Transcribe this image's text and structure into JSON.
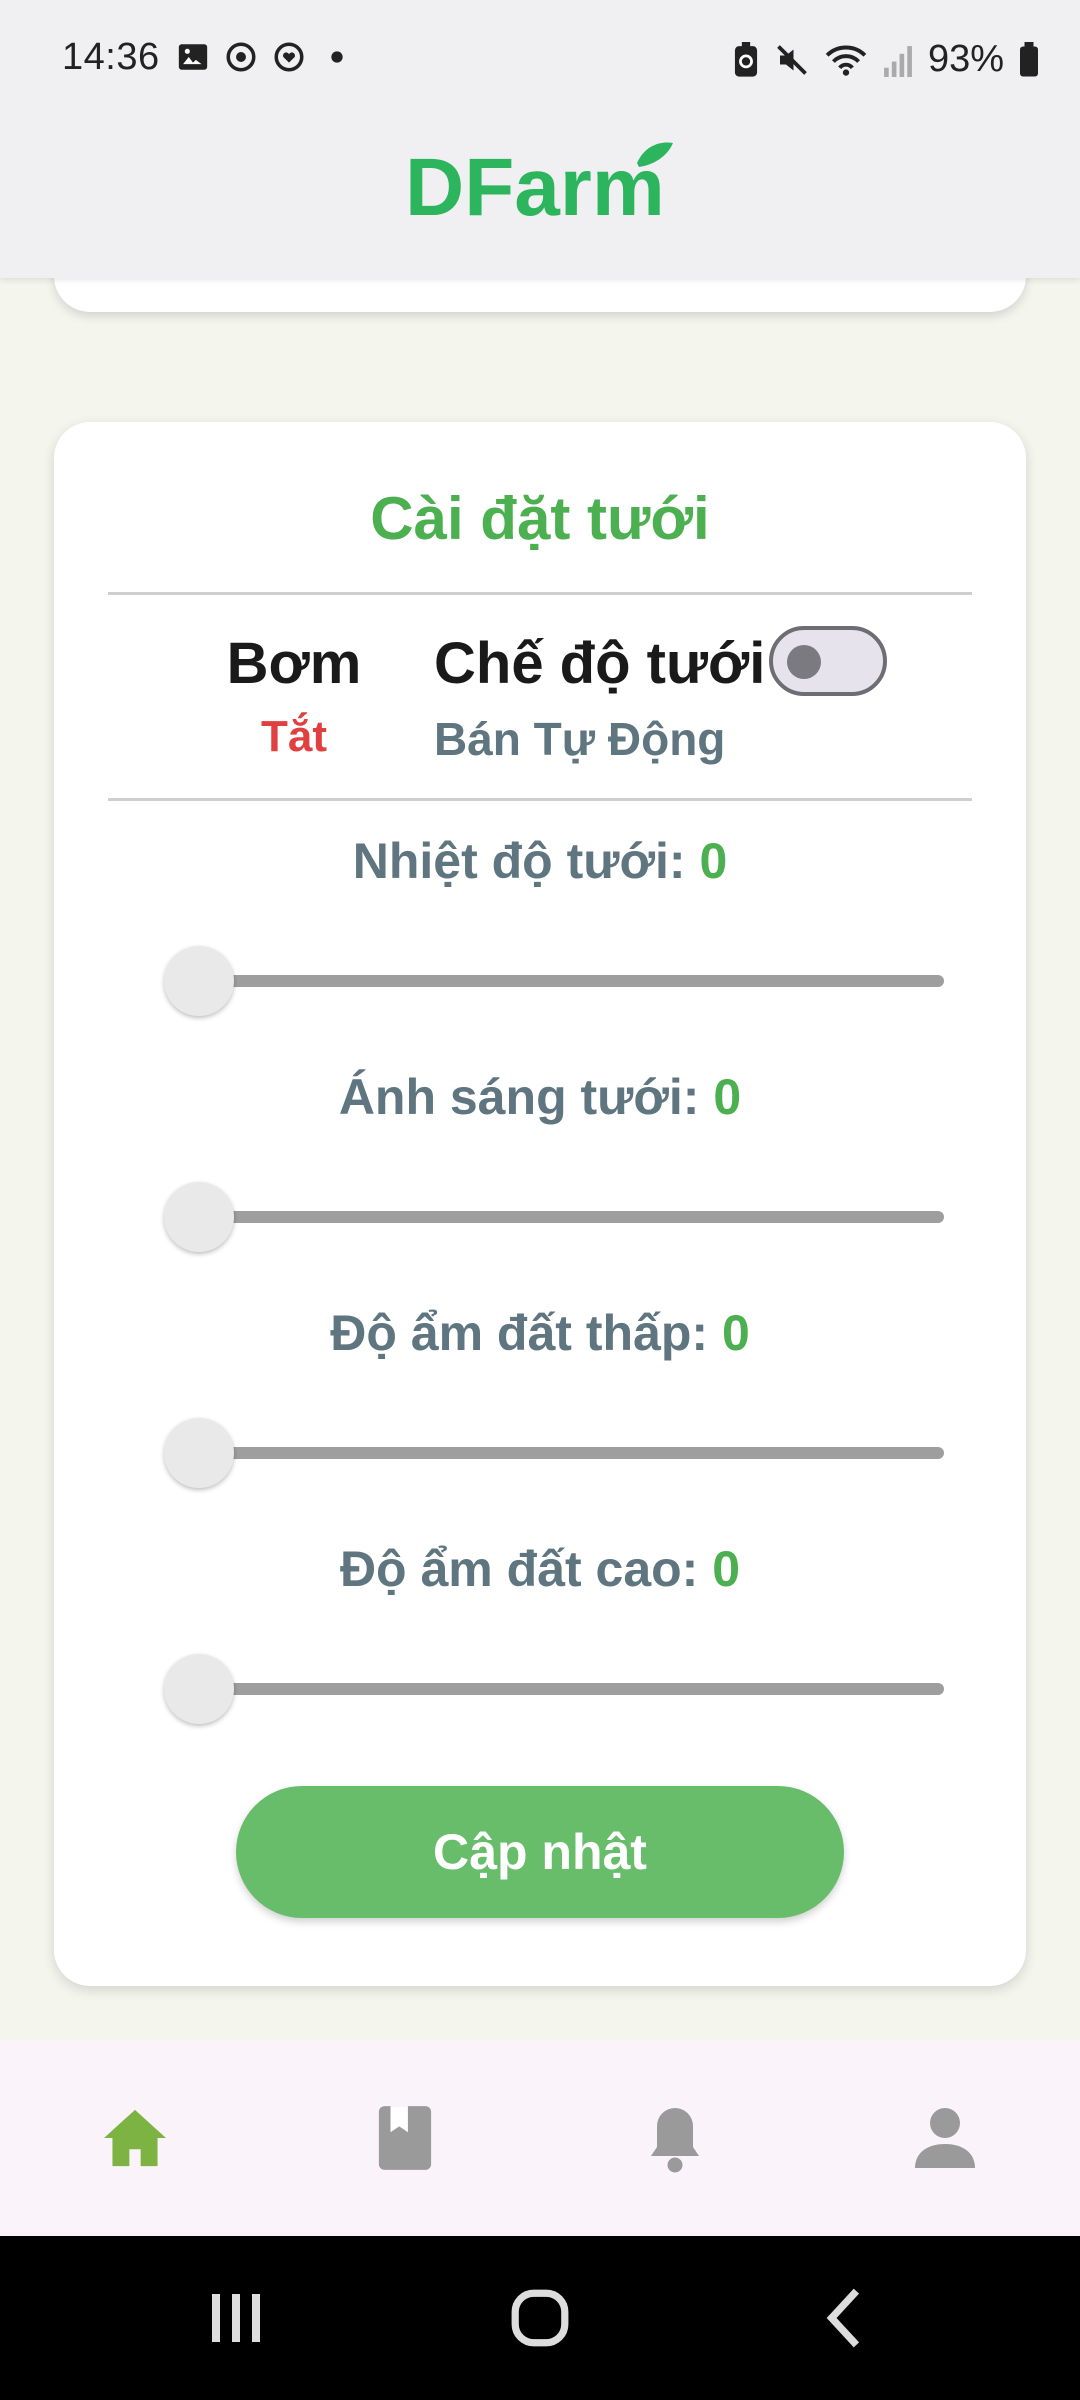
{
  "status_bar": {
    "time": "14:36",
    "battery_percent": "93%"
  },
  "header": {
    "logo_text": "DFarm",
    "logo_color": "#2db55d"
  },
  "settings_card": {
    "title": "Cài đặt tưới",
    "pump": {
      "label": "Bơm",
      "value": "Tắt"
    },
    "mode": {
      "label": "Chế độ tưới",
      "value": "Bán Tự Động",
      "toggle_on": false
    },
    "sliders": [
      {
        "label": "Nhiệt độ tưới:",
        "value": "0"
      },
      {
        "label": "Ánh sáng tưới:",
        "value": "0"
      },
      {
        "label": "Độ ẩm đất thấp:",
        "value": "0"
      },
      {
        "label": "Độ ẩm đất cao:",
        "value": "0"
      }
    ],
    "update_button": "Cập nhật"
  },
  "bottom_nav": {
    "items": [
      {
        "icon": "home-icon",
        "active": true
      },
      {
        "icon": "book-icon",
        "active": false
      },
      {
        "icon": "bell-icon",
        "active": false
      },
      {
        "icon": "person-icon",
        "active": false
      }
    ],
    "active_color": "#7cb342",
    "inactive_color": "#9a9a9a"
  },
  "colors": {
    "accent_green": "#4caf50",
    "button_green": "#67bd6a",
    "off_red": "#e04040",
    "muted_text": "#5f7580"
  }
}
